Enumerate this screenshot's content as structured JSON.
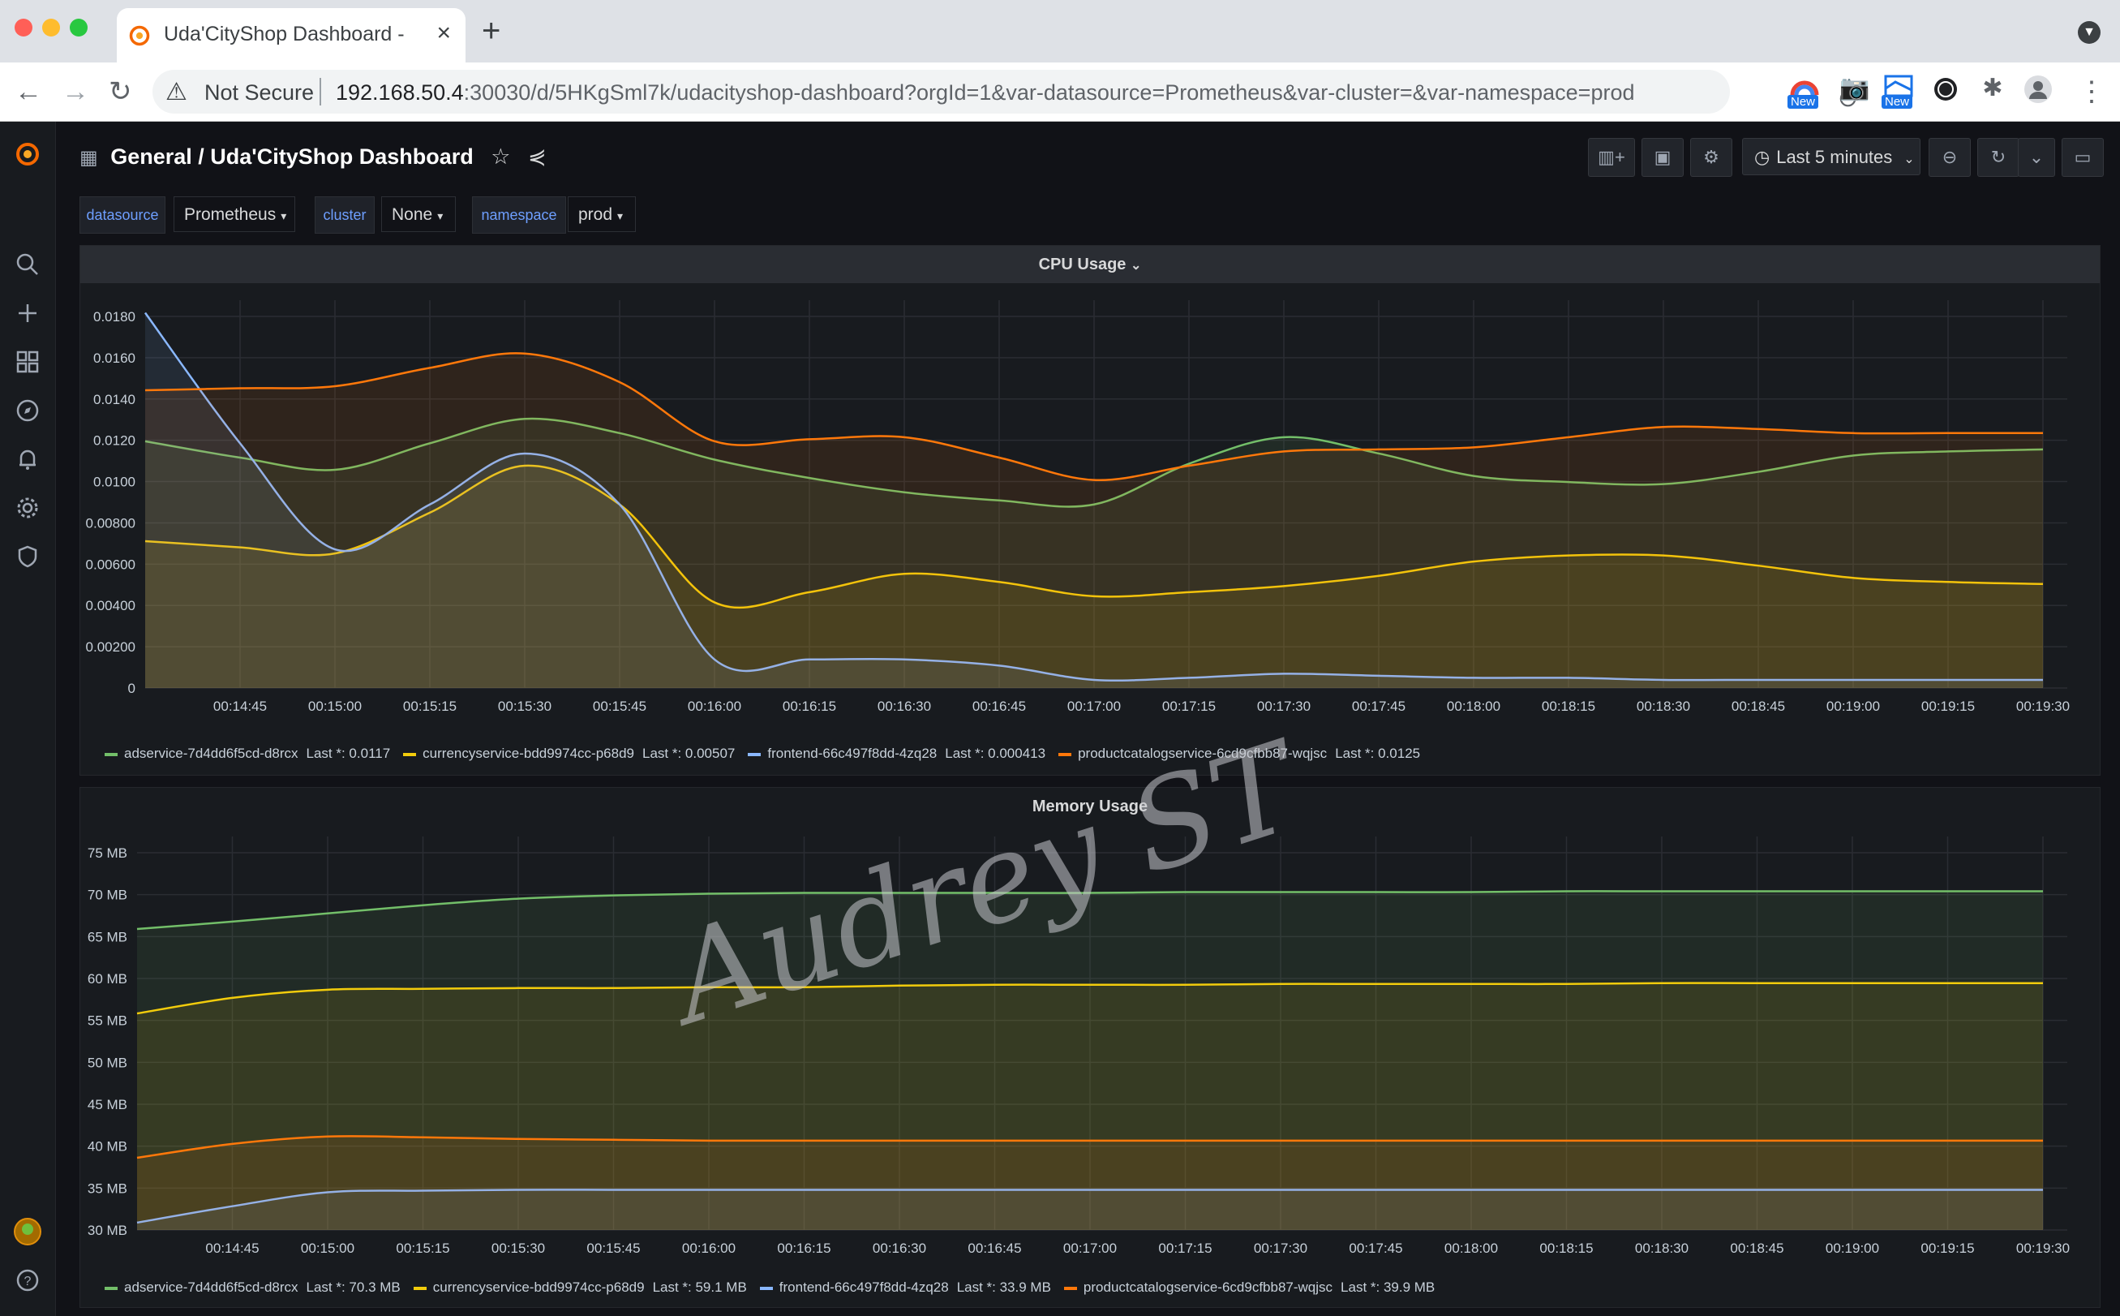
{
  "browser": {
    "tab_title": "Uda'CityShop Dashboard - Gra",
    "tab_close": "×",
    "new_tab": "+",
    "not_secure": "Not Secure",
    "url_host": "192.168.50.4",
    "url_rest": ":30030/d/5HKgSml7k/udacityshop-dashboard?orgId=1&var-datasource=Prometheus&var-cluster=&var-namespace=prod",
    "ext_new_label": "New"
  },
  "dashboard": {
    "folder": "General",
    "title": "/ Uda'CityShop Dashboard",
    "time_range": "Last 5 minutes",
    "variables": [
      {
        "label": "datasource",
        "value": "Prometheus"
      },
      {
        "label": "cluster",
        "value": "None"
      },
      {
        "label": "namespace",
        "value": "prod"
      }
    ]
  },
  "colors": {
    "green": "#73bf69",
    "yellow": "#f2cc0c",
    "blue": "#8ab8ff",
    "orange": "#ff780a",
    "background": "#111217",
    "panel": "#181b1f"
  },
  "watermark": "Audrey ST",
  "chart_data": [
    {
      "type": "area",
      "title": "CPU Usage",
      "x": [
        "00:14:30",
        "00:14:45",
        "00:15:00",
        "00:15:15",
        "00:15:30",
        "00:15:45",
        "00:16:00",
        "00:16:15",
        "00:16:30",
        "00:16:45",
        "00:17:00",
        "00:17:15",
        "00:17:30",
        "00:17:45",
        "00:18:00",
        "00:18:15",
        "00:18:30",
        "00:18:45",
        "00:19:00",
        "00:19:15",
        "00:19:30"
      ],
      "x_tick_labels": [
        "00:14:45",
        "00:15:00",
        "00:15:15",
        "00:15:30",
        "00:15:45",
        "00:16:00",
        "00:16:15",
        "00:16:30",
        "00:16:45",
        "00:17:00",
        "00:17:15",
        "00:17:30",
        "00:17:45",
        "00:18:00",
        "00:18:15",
        "00:18:30",
        "00:18:45",
        "00:19:00",
        "00:19:15",
        "00:19:30"
      ],
      "y_tick_labels": [
        "0",
        "0.00200",
        "0.00400",
        "0.00600",
        "0.00800",
        "0.0100",
        "0.0120",
        "0.0140",
        "0.0160",
        "0.0180"
      ],
      "ylim": [
        0,
        0.0185
      ],
      "series": [
        {
          "name": "adservice-7d4dd6f5cd-d8rcx",
          "last_label": "Last *: 0.0117",
          "color": "#73bf69",
          "values": [
            0.0121,
            0.0113,
            0.0107,
            0.012,
            0.0132,
            0.0125,
            0.0112,
            0.0103,
            0.0096,
            0.0092,
            0.009,
            0.011,
            0.0123,
            0.0115,
            0.0104,
            0.0101,
            0.01,
            0.0106,
            0.0114,
            0.0116,
            0.0117
          ]
        },
        {
          "name": "currencyservice-bdd9974cc-p68d9",
          "last_label": "Last *: 0.00507",
          "color": "#f2cc0c",
          "values": [
            0.0072,
            0.0069,
            0.0066,
            0.0086,
            0.0109,
            0.009,
            0.0042,
            0.0047,
            0.0056,
            0.0052,
            0.0045,
            0.0047,
            0.005,
            0.0055,
            0.0062,
            0.0065,
            0.0065,
            0.006,
            0.0054,
            0.0052,
            0.0051
          ]
        },
        {
          "name": "frontend-66c497f8dd-4zq28",
          "last_label": "Last *: 0.000413",
          "color": "#8ab8ff",
          "values": [
            0.0184,
            0.012,
            0.0068,
            0.009,
            0.0115,
            0.009,
            0.0014,
            0.0014,
            0.0014,
            0.0011,
            0.0004,
            0.0005,
            0.0007,
            0.0006,
            0.0005,
            0.0005,
            0.0004,
            0.0004,
            0.0004,
            0.0004,
            0.0004
          ]
        },
        {
          "name": "productcatalogservice-6cd9cfbb87-wqjsc",
          "last_label": "Last *: 0.0125",
          "color": "#ff780a",
          "values": [
            0.0146,
            0.0147,
            0.0148,
            0.0157,
            0.0164,
            0.015,
            0.0121,
            0.0122,
            0.0123,
            0.0113,
            0.0102,
            0.0109,
            0.0116,
            0.0117,
            0.0118,
            0.0123,
            0.0128,
            0.0127,
            0.0125,
            0.0125,
            0.0125
          ]
        }
      ]
    },
    {
      "type": "area",
      "title": "Memory Usage",
      "x": [
        "00:14:30",
        "00:14:45",
        "00:15:00",
        "00:15:15",
        "00:15:30",
        "00:15:45",
        "00:16:00",
        "00:16:15",
        "00:16:30",
        "00:16:45",
        "00:17:00",
        "00:17:15",
        "00:17:30",
        "00:17:45",
        "00:18:00",
        "00:18:15",
        "00:18:30",
        "00:18:45",
        "00:19:00",
        "00:19:15",
        "00:19:30"
      ],
      "x_tick_labels": [
        "00:14:45",
        "00:15:00",
        "00:15:15",
        "00:15:30",
        "00:15:45",
        "00:16:00",
        "00:16:15",
        "00:16:30",
        "00:16:45",
        "00:17:00",
        "00:17:15",
        "00:17:30",
        "00:17:45",
        "00:18:00",
        "00:18:15",
        "00:18:30",
        "00:18:45",
        "00:19:00",
        "00:19:15",
        "00:19:30"
      ],
      "y_tick_labels": [
        "30 MB",
        "35 MB",
        "40 MB",
        "45 MB",
        "50 MB",
        "55 MB",
        "60 MB",
        "65 MB",
        "70 MB",
        "75 MB"
      ],
      "ylim": [
        29,
        75
      ],
      "series": [
        {
          "name": "adservice-7d4dd6f5cd-d8rcx",
          "last_label": "Last *: 70.3 MB",
          "color": "#73bf69",
          "values": [
            65.7,
            66.6,
            67.6,
            68.6,
            69.4,
            69.8,
            70.0,
            70.1,
            70.1,
            70.1,
            70.1,
            70.2,
            70.2,
            70.2,
            70.2,
            70.3,
            70.3,
            70.3,
            70.3,
            70.3,
            70.3
          ]
        },
        {
          "name": "currencyservice-bdd9974cc-p68d9",
          "last_label": "Last *: 59.1 MB",
          "color": "#f2cc0c",
          "values": [
            55.4,
            57.3,
            58.3,
            58.4,
            58.5,
            58.5,
            58.6,
            58.6,
            58.8,
            58.9,
            58.9,
            58.9,
            59.0,
            59.0,
            59.0,
            59.0,
            59.1,
            59.1,
            59.1,
            59.1,
            59.1
          ]
        },
        {
          "name": "frontend-66c497f8dd-4zq28",
          "last_label": "Last *: 33.9 MB",
          "color": "#8ab8ff",
          "values": [
            29.9,
            31.9,
            33.6,
            33.8,
            33.9,
            33.9,
            33.9,
            33.9,
            33.9,
            33.9,
            33.9,
            33.9,
            33.9,
            33.9,
            33.9,
            33.9,
            33.9,
            33.9,
            33.9,
            33.9,
            33.9
          ]
        },
        {
          "name": "productcatalogservice-6cd9cfbb87-wqjsc",
          "last_label": "Last *: 39.9 MB",
          "color": "#ff780a",
          "values": [
            37.8,
            39.5,
            40.4,
            40.3,
            40.1,
            40.0,
            39.9,
            39.9,
            39.9,
            39.9,
            39.9,
            39.9,
            39.9,
            39.9,
            39.9,
            39.9,
            39.9,
            39.9,
            39.9,
            39.9,
            39.9
          ]
        }
      ]
    }
  ]
}
